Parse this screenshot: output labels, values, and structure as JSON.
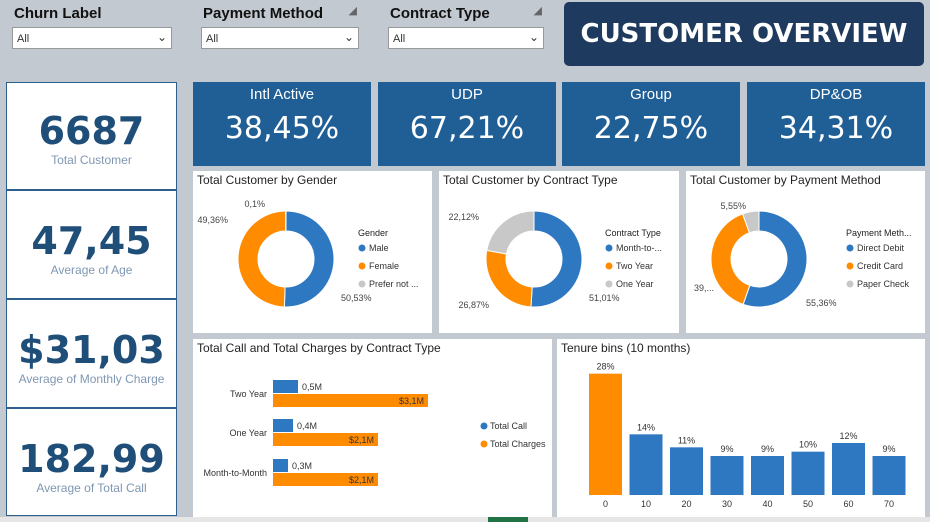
{
  "slicers": [
    {
      "title": "Churn Label",
      "value": "All"
    },
    {
      "title": "Payment Method",
      "value": "All"
    },
    {
      "title": "Contract Type",
      "value": "All"
    }
  ],
  "banner": "CUSTOMER OVERVIEW",
  "left_cards": [
    {
      "value": "6687",
      "label": "Total Customer"
    },
    {
      "value": "47,45",
      "label": "Average of Age"
    },
    {
      "value": "$31,03",
      "label": "Average of Monthly Charge"
    },
    {
      "value": "182,99",
      "label": "Average of Total Call"
    }
  ],
  "kpis": [
    {
      "title": "Intl Active",
      "value": "38,45%"
    },
    {
      "title": "UDP",
      "value": "67,21%"
    },
    {
      "title": "Group",
      "value": "22,75%"
    },
    {
      "title": "DP&OB",
      "value": "34,31%"
    }
  ],
  "colors": {
    "blue": "#2e78c2",
    "orange": "#ff8c00",
    "gray": "#c8c8c8",
    "navy": "#1f3a5f"
  },
  "chart_data": [
    {
      "type": "pie",
      "title": "Total Customer by Gender",
      "legend_title": "Gender",
      "legend": [
        "Male",
        "Female",
        "Prefer not ..."
      ],
      "values": [
        50.53,
        49.36,
        0.1
      ],
      "labels": [
        "50,53%",
        "49,36%",
        "0,1%"
      ],
      "colors": [
        "#2e78c2",
        "#ff8c00",
        "#c8c8c8"
      ]
    },
    {
      "type": "pie",
      "title": "Total Customer by Contract Type",
      "legend_title": "Contract Type",
      "legend": [
        "Month-to-...",
        "Two Year",
        "One Year"
      ],
      "values": [
        51.01,
        26.87,
        22.12
      ],
      "labels": [
        "51,01%",
        "26,87%",
        "22,12%"
      ],
      "colors": [
        "#2e78c2",
        "#ff8c00",
        "#c8c8c8"
      ]
    },
    {
      "type": "pie",
      "title": "Total Customer by Payment Method",
      "legend_title": "Payment Meth...",
      "legend": [
        "Direct Debit",
        "Credit Card",
        "Paper Check"
      ],
      "values": [
        55.36,
        39.09,
        5.55
      ],
      "labels": [
        "55,36%",
        "39,...",
        "5,55%"
      ],
      "colors": [
        "#2e78c2",
        "#ff8c00",
        "#c8c8c8"
      ]
    },
    {
      "type": "bar",
      "title": "Total Call and Total Charges by Contract Type",
      "categories": [
        "Two Year",
        "One Year",
        "Month-to-Month"
      ],
      "series": [
        {
          "name": "Total Call",
          "values": [
            0.5,
            0.4,
            0.3
          ],
          "labels": [
            "0,5M",
            "0,4M",
            "0,3M"
          ]
        },
        {
          "name": "Total Charges",
          "values": [
            3.1,
            2.1,
            2.1
          ],
          "labels": [
            "$3,1M",
            "$2,1M",
            "$2,1M"
          ]
        }
      ],
      "xlim": [
        0,
        4.2
      ]
    },
    {
      "type": "bar",
      "title": "Tenure bins (10 months)",
      "categories": [
        "0",
        "10",
        "20",
        "30",
        "40",
        "50",
        "60",
        "70"
      ],
      "values": [
        28,
        14,
        11,
        9,
        9,
        10,
        12,
        9
      ],
      "labels": [
        "28%",
        "14%",
        "11%",
        "9%",
        "9%",
        "10%",
        "12%",
        "9%"
      ],
      "ylim": [
        0,
        30
      ]
    }
  ]
}
